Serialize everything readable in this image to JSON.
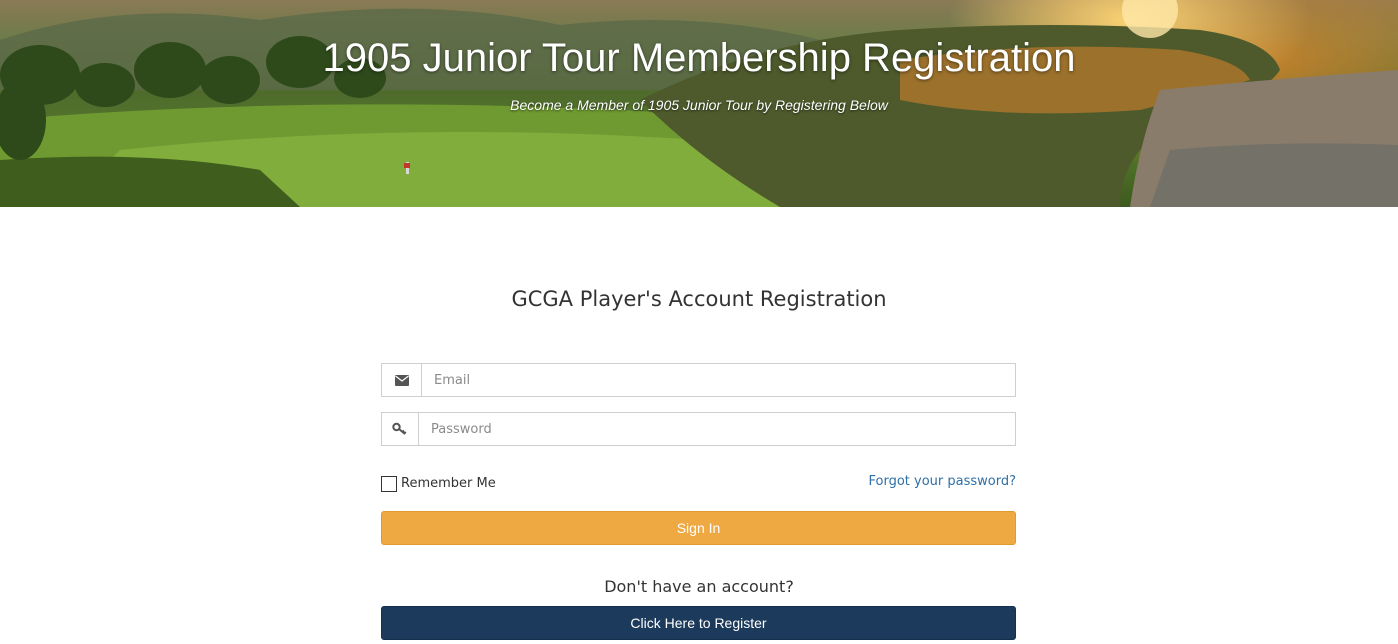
{
  "hero": {
    "title": "1905 Junior Tour Membership Registration",
    "subtitle": "Become a Member of 1905 Junior Tour by Registering Below"
  },
  "form": {
    "heading": "GCGA Player's Account Registration",
    "email": {
      "placeholder": "Email",
      "value": "",
      "icon": "envelope-icon"
    },
    "password": {
      "placeholder": "Password",
      "value": "",
      "icon": "key-icon"
    },
    "remember_label": "Remember Me",
    "remember_checked": false,
    "forgot_label": "Forgot your password?",
    "signin_label": "Sign In",
    "no_account_text": "Don't have an account?",
    "register_label": "Click Here to Register"
  },
  "colors": {
    "signin_button": "#efa942",
    "register_button": "#1c3a5b",
    "link": "#2f6fa6"
  }
}
